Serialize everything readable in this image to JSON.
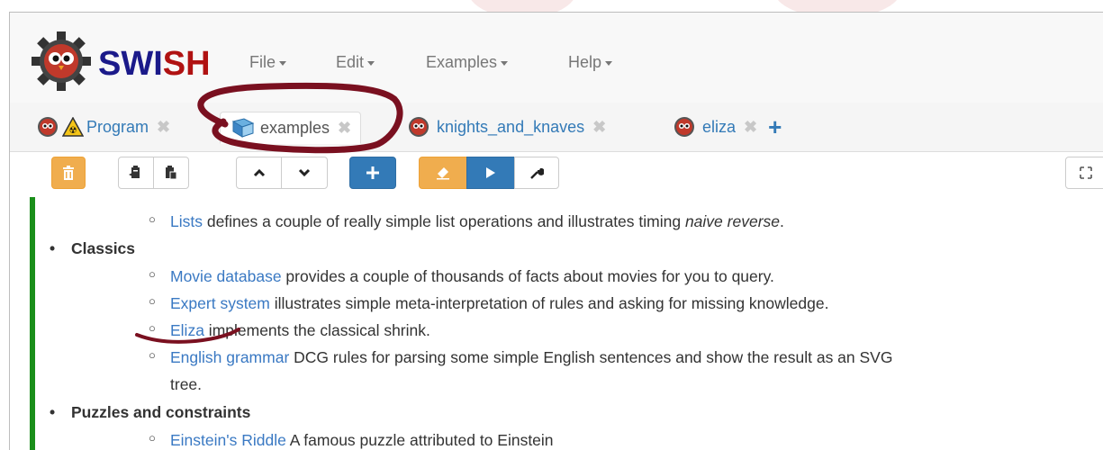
{
  "app": {
    "brand_a": "SWI",
    "brand_b": "SH"
  },
  "menu": [
    {
      "label": "File"
    },
    {
      "label": "Edit"
    },
    {
      "label": "Examples"
    },
    {
      "label": "Help"
    }
  ],
  "tabs": [
    {
      "label": "Program",
      "active": false
    },
    {
      "label": "examples",
      "active": true
    },
    {
      "label": "knights_and_knaves",
      "active": false
    },
    {
      "label": "eliza",
      "active": false
    }
  ],
  "new_tab_symbol": "+",
  "toolbar": {
    "icons": [
      "trash-icon",
      "copy-icon",
      "paste-icon",
      "arrow-up-icon",
      "arrow-down-icon",
      "plus-icon",
      "eraser-icon",
      "play-icon",
      "wrench-icon",
      "fullscreen-icon"
    ]
  },
  "colors": {
    "accent_green": "#1a8f1a",
    "link_blue": "#3a79c3",
    "warning_orange": "#f0ad4e",
    "primary_blue": "#337ab7",
    "annotation_maroon": "#7a1020"
  },
  "content": {
    "lists_item": {
      "link": "Lists",
      "text": " defines a couple of really simple list operations and illustrates timing ",
      "italic": "naive reverse",
      "end": "."
    },
    "classics_heading": "Classics",
    "classics": [
      {
        "link": "Movie database",
        "text": " provides a couple of thousands of facts about movies for you to query."
      },
      {
        "link": "Expert system",
        "text": " illustrates simple meta-interpretation of rules and asking for missing knowledge."
      },
      {
        "link": "Eliza",
        "text": " implements the classical shrink."
      },
      {
        "link": "English grammar",
        "text": " DCG rules for parsing some simple English sentences and show the result as an SVG",
        "wrap": "tree."
      }
    ],
    "puzzles_heading": "Puzzles and constraints",
    "puzzles": [
      {
        "link": "Einstein's Riddle",
        "text": " A famous puzzle attributed to Einstein"
      }
    ]
  }
}
